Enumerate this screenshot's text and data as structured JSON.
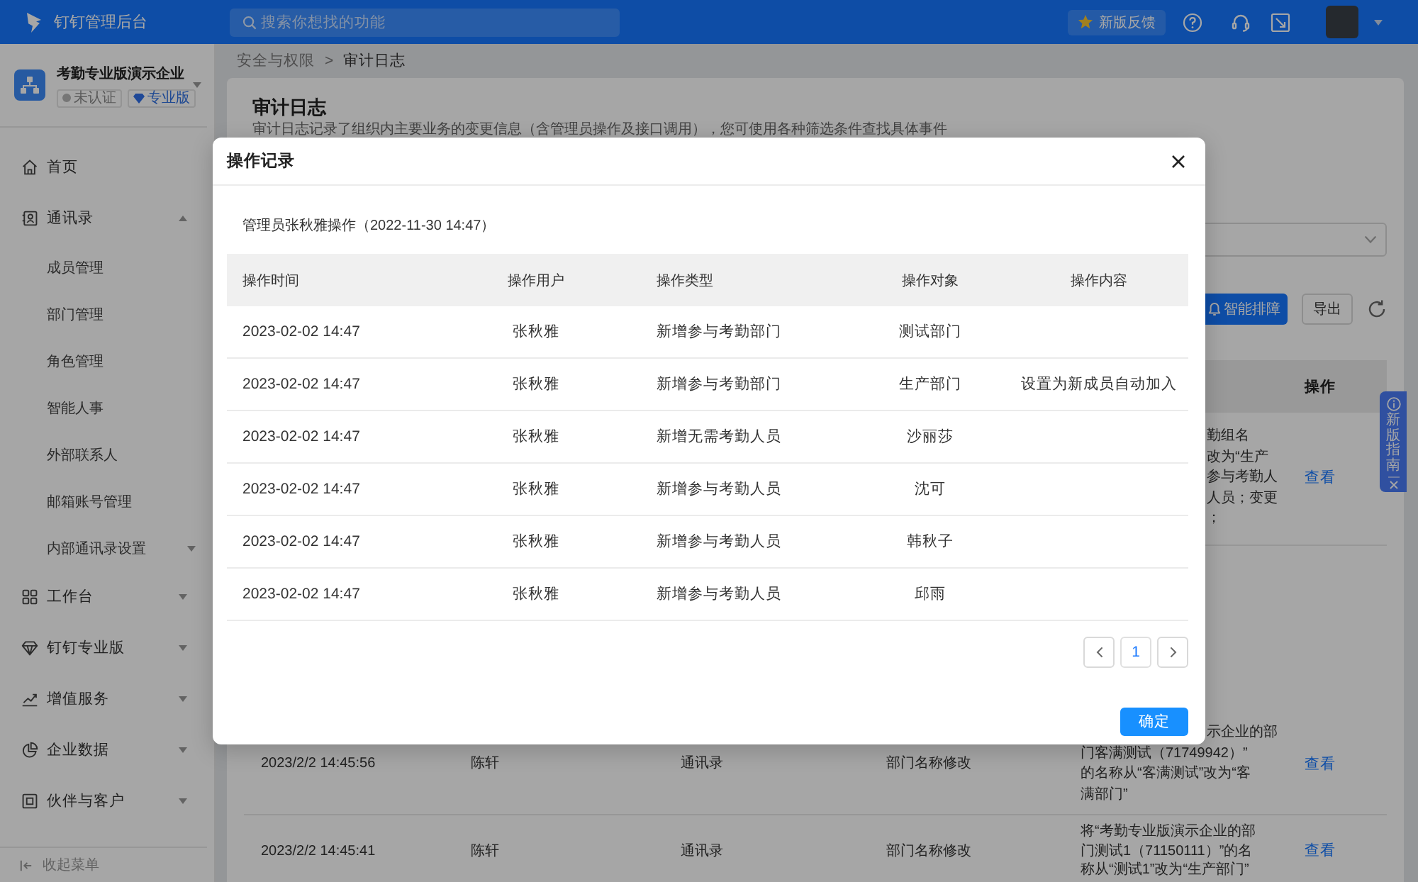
{
  "top_bar": {
    "title": "钉钉管理后台",
    "search": {
      "placeholder": "搜索你想找的功能"
    },
    "feedback_button": "新版反馈"
  },
  "sidebar": {
    "org": {
      "name": "考勤专业版演示企业",
      "badges": [
        {
          "label": "未认证",
          "kind": "status"
        },
        {
          "label": "专业版",
          "kind": "edition"
        }
      ]
    },
    "items": [
      {
        "label": "首页"
      },
      {
        "label": "通讯录",
        "expanded": true,
        "children": [
          {
            "label": "成员管理"
          },
          {
            "label": "部门管理"
          },
          {
            "label": "角色管理"
          },
          {
            "label": "智能人事"
          },
          {
            "label": "外部联系人"
          },
          {
            "label": "邮箱账号管理"
          },
          {
            "label": "内部通讯录设置",
            "expanded": false
          }
        ]
      },
      {
        "label": "工作台",
        "expanded": false
      },
      {
        "label": "钉钉专业版",
        "expanded": false
      },
      {
        "label": "增值服务",
        "expanded": false
      },
      {
        "label": "企业数据",
        "expanded": false
      },
      {
        "label": "伙伴与客户",
        "expanded": false
      }
    ],
    "collapse_button": "收起菜单"
  },
  "breadcrumb": {
    "items": [
      "安全与权限",
      "审计日志"
    ],
    "separator": ">"
  },
  "page": {
    "title": "审计日志",
    "description": "审计日志记录了组织内主要业务的变更信息（含管理员操作及接口调用），您可使用各种筛选条件查找具体事件",
    "actions": [
      {
        "label": "智能排障",
        "kind": "primary"
      },
      {
        "label": "导出",
        "kind": "default"
      }
    ],
    "table": {
      "action_header": "操作",
      "rows": [
        {
          "content_lines": [
            {
              "text": "勤组名",
              "covered": true
            },
            {
              "text": "改为“生产",
              "covered": true
            },
            {
              "text": "参与考勤人",
              "covered": true
            },
            {
              "text": "人员；变更",
              "covered": true
            },
            {
              "text": "；",
              "covered": true
            }
          ],
          "action": "查看"
        },
        {
          "cells": [
            "2023/2/2 14:45:56",
            "陈轩",
            "通讯录",
            "部门名称修改"
          ],
          "content_lines": [
            {
              "text": "示企业的部",
              "covered": true
            },
            {
              "text": "门客满测试（71749942）”",
              "covered": false
            },
            {
              "text": "的名称从“客满测试”改为“客",
              "covered": false
            },
            {
              "text": "满部门”",
              "covered": false
            }
          ],
          "action": "查看"
        },
        {
          "cells": [
            "2023/2/2 14:45:41",
            "陈轩",
            "通讯录",
            "部门名称修改"
          ],
          "content_lines": [
            {
              "text": "将“考勤专业版演示企业的部",
              "covered": false
            },
            {
              "text": "门测试1（71150111）”的名",
              "covered": false
            },
            {
              "text": "称从“测试1”改为“生产部门”",
              "covered": false
            }
          ],
          "action": "查看"
        }
      ]
    }
  },
  "guide_tab": {
    "label": "新版指南"
  },
  "dialog": {
    "title": "操作记录",
    "summary": "管理员张秋雅操作（2022-11-30 14:47）",
    "table": {
      "columns": [
        "操作时间",
        "操作用户",
        "操作类型",
        "操作对象",
        "操作内容"
      ],
      "rows": [
        [
          "2023-02-02 14:47",
          "张秋雅",
          "新增参与考勤部门",
          "测试部门"
        ],
        [
          "2023-02-02 14:47",
          "张秋雅",
          "新增参与考勤部门",
          "生产部门",
          "设置为新成员自动加入"
        ],
        [
          "2023-02-02 14:47",
          "张秋雅",
          "新增无需考勤人员",
          "沙丽莎"
        ],
        [
          "2023-02-02 14:47",
          "张秋雅",
          "新增参与考勤人员",
          "沈可"
        ],
        [
          "2023-02-02 14:47",
          "张秋雅",
          "新增参与考勤人员",
          "韩秋子"
        ],
        [
          "2023-02-02 14:47",
          "张秋雅",
          "新增参与考勤人员",
          "邱雨"
        ]
      ]
    },
    "pagination": {
      "pages": [
        {
          "label": "1",
          "selected": true
        }
      ]
    },
    "confirm_button": "确定"
  }
}
